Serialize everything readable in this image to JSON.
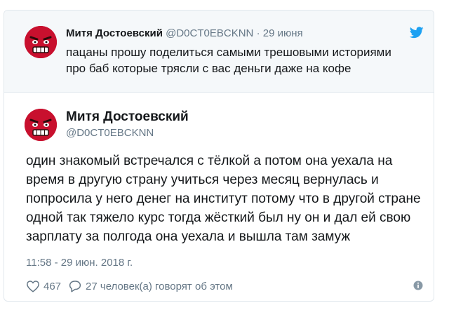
{
  "quoted_tweet": {
    "name": "Митя Достоевский",
    "handle": "@D0CT0EBCKNN",
    "separator": "·",
    "date": "29 июня",
    "text": "пацаны прошу поделиться самыми трешовыми историями про баб которые трясли с вас деньги даже на кофе"
  },
  "main_tweet": {
    "name": "Митя Достоевский",
    "handle": "@D0CT0EBCKNN",
    "text": "один знакомый встречался с тёлкой а потом она уехала на время в другую страну учиться через месяц вернулась и попросила у него денег на институт потому что в другой стране одной так тяжело курс тогда жёсткий был ну он и дал ей свою зарплату за полгода она уехала и вышла там замуж",
    "timestamp": "11:58 - 29 июн. 2018 г.",
    "likes": "467",
    "replies": "27 человек(а) говорят об этом"
  },
  "colors": {
    "avatar_red": "#c8102e",
    "twitter_blue": "#1da1f2",
    "muted_text": "#657786",
    "border": "#e1e8ed"
  },
  "icons": [
    "twitter-bird-icon",
    "heart-icon",
    "reply-bubble-icon",
    "info-icon"
  ]
}
